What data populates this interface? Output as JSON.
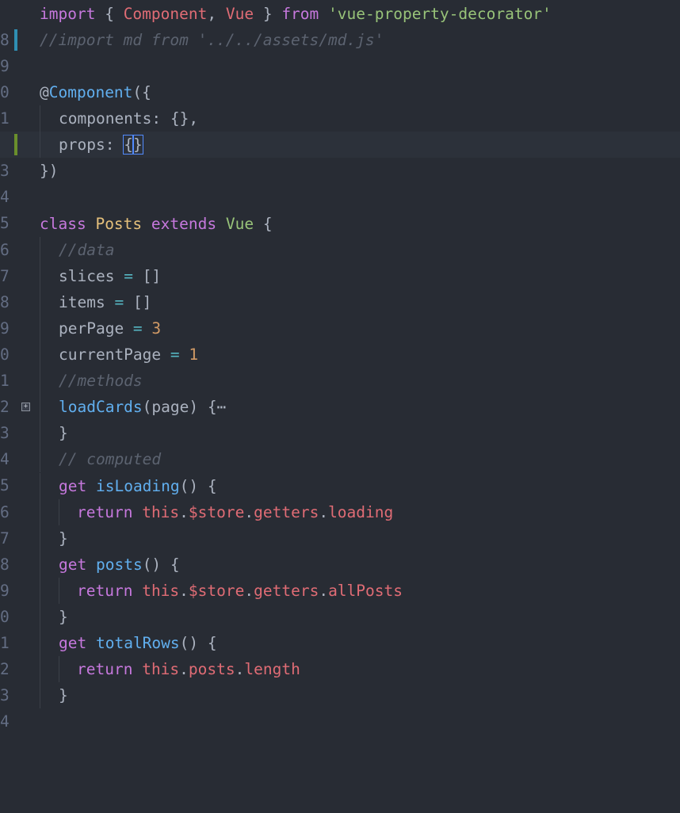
{
  "gutter_numbers": [
    "8",
    "9",
    "0",
    "",
    "1",
    "2",
    "3",
    "4",
    "5",
    "6",
    "7",
    "8",
    "9",
    "0",
    "1",
    "2",
    "3",
    "4",
    "5",
    "6",
    "7",
    "8",
    "9",
    "0",
    "1",
    "2",
    "3",
    "4"
  ],
  "code": {
    "l0": {
      "kw_import": "import",
      "p1": " { ",
      "comp": "Component",
      "p2": ", ",
      "vue": "Vue",
      "p3": " } ",
      "from": "from",
      "p4": " ",
      "str": "'vue-property-decorator'"
    },
    "l1": {
      "comment": "//import md from '../../assets/md.js'"
    },
    "l3": {
      "at": "@",
      "dec": "Component",
      "p": "({"
    },
    "l4": {
      "text": "components: {},"
    },
    "l5": {
      "key": "props: ",
      "open": "{",
      "close": "}"
    },
    "l6": {
      "text": "})"
    },
    "l8": {
      "kw_class": "class",
      "sp": " ",
      "name": "Posts",
      "sp2": " ",
      "kw_extends": "extends",
      "sp3": " ",
      "vue": "Vue",
      "p": " {"
    },
    "l9": {
      "comment": "//data"
    },
    "l10": {
      "name": "slices",
      "op": " = ",
      "val": "[]"
    },
    "l11": {
      "name": "items",
      "op": " = ",
      "val": "[]"
    },
    "l12": {
      "name": "perPage",
      "op": " = ",
      "val": "3"
    },
    "l13": {
      "name": "currentPage",
      "op": " = ",
      "val": "1"
    },
    "l14": {
      "comment": "//methods"
    },
    "l15": {
      "fn": "loadCards",
      "args": "(page) {",
      "dots": "⋯"
    },
    "l16": {
      "text": "}"
    },
    "l17": {
      "comment": "// computed"
    },
    "l18": {
      "kw": "get",
      "sp": " ",
      "fn": "isLoading",
      "p": "() {"
    },
    "l19": {
      "ret": "return",
      "sp": " ",
      "this": "this",
      "d1": ".",
      "p1": "$store",
      "d2": ".",
      "p2": "getters",
      "d3": ".",
      "p3": "loading"
    },
    "l20": {
      "text": "}"
    },
    "l21": {
      "kw": "get",
      "sp": " ",
      "fn": "posts",
      "p": "() {"
    },
    "l22": {
      "ret": "return",
      "sp": " ",
      "this": "this",
      "d1": ".",
      "p1": "$store",
      "d2": ".",
      "p2": "getters",
      "d3": ".",
      "p3": "allPosts"
    },
    "l23": {
      "text": "}"
    },
    "l24": {
      "kw": "get",
      "sp": " ",
      "fn": "totalRows",
      "p": "() {"
    },
    "l25": {
      "ret": "return",
      "sp": " ",
      "this": "this",
      "d1": ".",
      "p1": "posts",
      "d2": ".",
      "p2": "length"
    },
    "l26": {
      "text": "}"
    }
  },
  "colors": {
    "background": "#282c34",
    "git_modified": "#2f8fb3",
    "git_added": "#6a8f2c",
    "cursor": "#528bff"
  },
  "icons": {
    "fold": "fold-expand-icon"
  }
}
